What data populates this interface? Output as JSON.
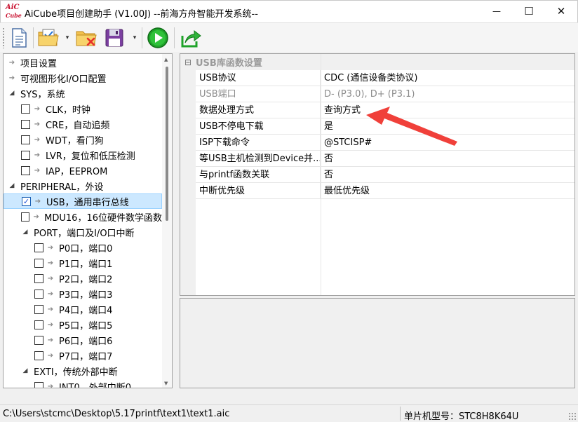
{
  "window": {
    "logo_line1": "AiC",
    "logo_line2": "Cube",
    "title": "AiCube项目创建助手 (V1.00J) --前海方舟智能开发系统--",
    "minimize_glyph": "—",
    "maximize_glyph": "☐",
    "close_glyph": "✕"
  },
  "toolbar": {
    "buttons": [
      {
        "name": "new-document",
        "icon": "document-icon"
      },
      {
        "name": "open-folder",
        "icon": "folder-check-icon"
      },
      {
        "name": "close-project",
        "icon": "folder-delete-icon"
      },
      {
        "name": "save",
        "icon": "floppy-disk-icon"
      },
      {
        "name": "run",
        "icon": "play-icon"
      },
      {
        "name": "export",
        "icon": "share-arrow-icon"
      }
    ],
    "dropdown_glyph": "▾"
  },
  "tree": {
    "items": [
      {
        "label": "项目设置",
        "type": "leaf",
        "indent": 0
      },
      {
        "label": "可视图形化I/O口配置",
        "type": "leaf",
        "indent": 0
      },
      {
        "label": "SYS，系统",
        "type": "group",
        "indent": 0
      },
      {
        "label": "CLK，时钟",
        "type": "check",
        "indent": 1,
        "checked": false
      },
      {
        "label": "CRE，自动追频",
        "type": "check",
        "indent": 1,
        "checked": false
      },
      {
        "label": "WDT，看门狗",
        "type": "check",
        "indent": 1,
        "checked": false
      },
      {
        "label": "LVR，复位和低压检测",
        "type": "check",
        "indent": 1,
        "checked": false
      },
      {
        "label": "IAP，EEPROM",
        "type": "check",
        "indent": 1,
        "checked": false
      },
      {
        "label": "PERIPHERAL，外设",
        "type": "group",
        "indent": 0
      },
      {
        "label": "USB，通用串行总线",
        "type": "check",
        "indent": 1,
        "checked": true,
        "selected": true
      },
      {
        "label": "MDU16，16位硬件数学函数",
        "type": "check",
        "indent": 1,
        "checked": false
      },
      {
        "label": "PORT，端口及I/O口中断",
        "type": "group",
        "indent": 1
      },
      {
        "label": "P0口，端口0",
        "type": "check",
        "indent": 2,
        "checked": false
      },
      {
        "label": "P1口，端口1",
        "type": "check",
        "indent": 2,
        "checked": false
      },
      {
        "label": "P2口，端口2",
        "type": "check",
        "indent": 2,
        "checked": false
      },
      {
        "label": "P3口，端口3",
        "type": "check",
        "indent": 2,
        "checked": false
      },
      {
        "label": "P4口，端口4",
        "type": "check",
        "indent": 2,
        "checked": false
      },
      {
        "label": "P5口，端口5",
        "type": "check",
        "indent": 2,
        "checked": false
      },
      {
        "label": "P6口，端口6",
        "type": "check",
        "indent": 2,
        "checked": false
      },
      {
        "label": "P7口，端口7",
        "type": "check",
        "indent": 2,
        "checked": false
      },
      {
        "label": "EXTI，传统外部中断",
        "type": "group",
        "indent": 1
      },
      {
        "label": "INT0，外部中断0",
        "type": "check",
        "indent": 2,
        "checked": false
      }
    ],
    "check_glyph": "✓",
    "arrow_leaf": "➔",
    "arrow_open": "◢"
  },
  "properties": {
    "category": "USB库函数设置",
    "collapse_glyph": "⊟",
    "rows": [
      {
        "name": "USB协议",
        "value": "CDC (通信设备类协议)",
        "disabled": false
      },
      {
        "name": "USB端口",
        "value": "D- (P3.0), D+ (P3.1)",
        "disabled": true
      },
      {
        "name": "数据处理方式",
        "value": "查询方式",
        "disabled": false
      },
      {
        "name": "USB不停电下载",
        "value": "是",
        "disabled": false
      },
      {
        "name": "ISP下载命令",
        "value": "@STCISP#",
        "disabled": false
      },
      {
        "name": "等USB主机检测到Device并...",
        "value": "否",
        "disabled": false
      },
      {
        "name": "与printf函数关联",
        "value": "否",
        "disabled": false
      },
      {
        "name": "中断优先级",
        "value": "最低优先级",
        "disabled": false
      }
    ]
  },
  "statusbar": {
    "path": "C:\\Users\\stcmc\\Desktop\\5.17printf\\text1\\text1.aic",
    "mcu": "单片机型号：STC8H8K64U"
  },
  "colors": {
    "annotation_arrow": "#f0403a",
    "selection_bg": "#cce8ff",
    "run_green": "#1fa32a",
    "folder_yellow": "#f2c14e"
  }
}
